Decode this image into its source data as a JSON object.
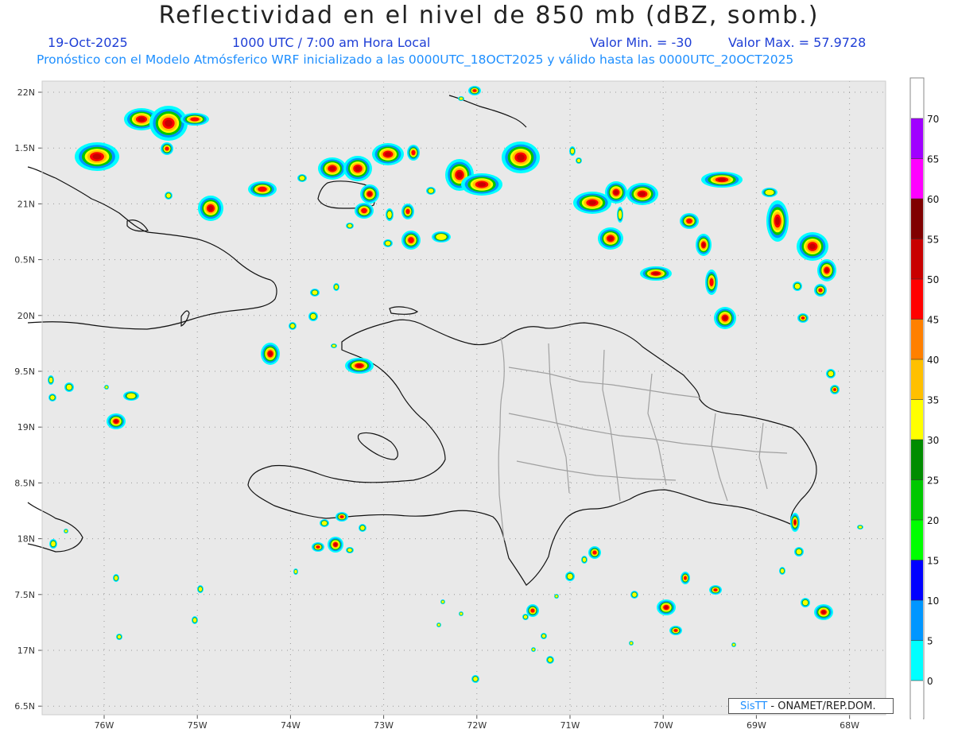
{
  "header": {
    "title": "Reflectividad en el nivel de 850 mb (dBZ, somb.)",
    "date": "19-Oct-2025",
    "time": "1000 UTC / 7:00 am Hora Local",
    "min_label": "Valor Min. = -30",
    "max_label": "Valor Max. = 57.9728",
    "model_line": "Pronóstico con el Modelo Atmósferico WRF inicializado a las 0000UTC_18OCT2025 y válido hasta las  0000UTC_20OCT2025"
  },
  "map": {
    "lon_labels": [
      "76W",
      "75W",
      "74W",
      "73W",
      "72W",
      "71W",
      "70W",
      "69W",
      "68W"
    ],
    "lat_labels": [
      "22N",
      "1.5N",
      "21N",
      "0.5N",
      "20N",
      "9.5N",
      "19N",
      "8.5N",
      "18N",
      "7.5N",
      "17N",
      "6.5N"
    ],
    "lon_values": [
      -76,
      -75,
      -74,
      -73,
      -72,
      -71,
      -70,
      -69,
      -68
    ],
    "lat_values": [
      22,
      21.5,
      21,
      20.5,
      20,
      19.5,
      19,
      18.5,
      18,
      17.5,
      17,
      16.5
    ],
    "background_color": "#e9e9e9",
    "coast_color": "#111111",
    "province_border_color": "#a0a0a0"
  },
  "colorbar": {
    "labels": [
      "70",
      "65",
      "60",
      "55",
      "50",
      "45",
      "40",
      "35",
      "30",
      "25",
      "20",
      "15",
      "10",
      "5",
      "0"
    ],
    "colors": [
      "#a000ff",
      "#ff00ff",
      "#800000",
      "#c80000",
      "#ff0000",
      "#ff8000",
      "#ffc000",
      "#ffff00",
      "#008c00",
      "#00c800",
      "#00ff00",
      "#0000ff",
      "#0096ff",
      "#00ffff",
      "#ffffff",
      "#e8e8e8"
    ]
  },
  "credit": {
    "brand": "SisTT",
    "text": " - ONAMET/REP.DOM."
  },
  "reflectivity_colors": {
    "c5": "#00ffff",
    "c10": "#0096ff",
    "c20": "#00c800",
    "c30": "#ffff00",
    "c35": "#ffc000",
    "c45": "#ff0000",
    "c50": "#c80000"
  }
}
